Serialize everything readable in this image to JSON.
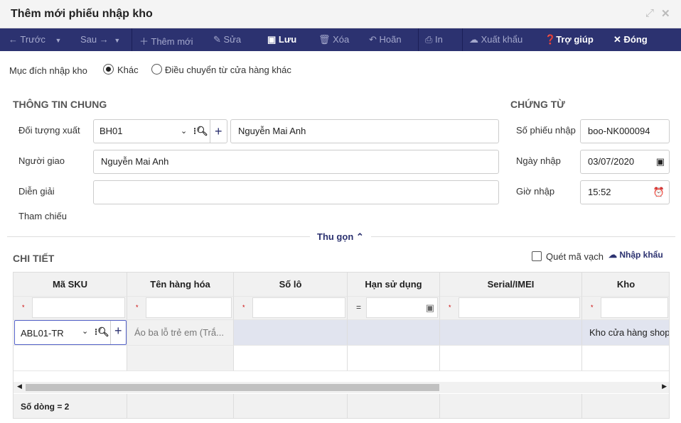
{
  "window": {
    "title": "Thêm mới phiếu nhập kho"
  },
  "toolbar": {
    "prev": "Trước",
    "next": "Sau",
    "add": "Thêm mới",
    "edit": "Sửa",
    "save": "Lưu",
    "delete": "Xóa",
    "undo": "Hoãn",
    "print": "In",
    "export": "Xuất khẩu",
    "help": "Trợ giúp",
    "close": "Đóng"
  },
  "purpose": {
    "label": "Mục đích nhập kho",
    "options": [
      "Khác",
      "Điều chuyển từ cửa hàng khác"
    ],
    "selected": "Khác"
  },
  "general": {
    "title": "THÔNG TIN CHUNG",
    "object_label": "Đối tượng xuất",
    "object_code": "BH01",
    "object_name": "Nguyễn Mai Anh",
    "deliverer_label": "Người giao",
    "deliverer": "Nguyễn Mai Anh",
    "description_label": "Diễn giải",
    "description": "",
    "reference_label": "Tham chiếu"
  },
  "voucher": {
    "title": "CHỨNG TỪ",
    "number_label": "Số phiếu nhập",
    "number": "boo-NK000094",
    "date_label": "Ngày nhập",
    "date": "03/07/2020",
    "time_label": "Giờ nhập",
    "time": "15:52"
  },
  "collapse": "Thu gọn",
  "detail": {
    "title": "CHI TIẾT",
    "scan_label": "Quét mã vạch",
    "import_label": "Nhập khẩu",
    "columns": [
      "Mã SKU",
      "Tên hàng hóa",
      "Số lô",
      "Hạn sử dụng",
      "Serial/IMEI",
      "Kho"
    ],
    "filter_ops": [
      "*",
      "*",
      "*",
      "=",
      "*",
      "*"
    ],
    "rows": [
      {
        "sku": "ABL01-TR",
        "name": "Áo ba lỗ trẻ em (Trắ...",
        "lot": "",
        "expiry": "",
        "serial": "",
        "warehouse": "Kho cửa hàng shop"
      }
    ],
    "footer": "Số dòng = 2"
  },
  "colors": {
    "toolbar": "#2c3270",
    "accent": "#2c3270"
  }
}
